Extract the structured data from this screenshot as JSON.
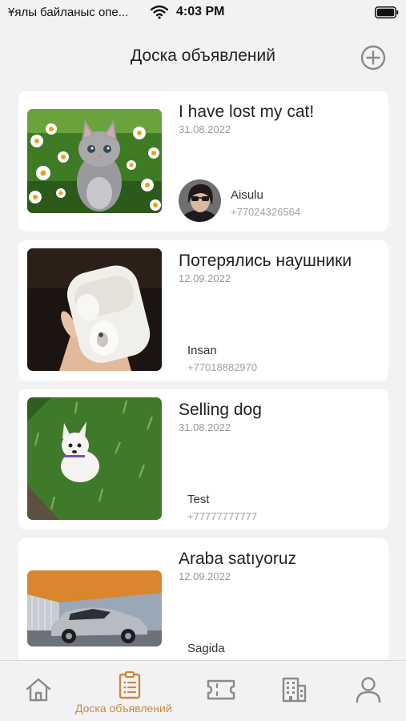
{
  "status_bar": {
    "carrier": "Ұялы байланыс опе...",
    "time": "4:03 PM"
  },
  "header": {
    "title": "Доска объявлений"
  },
  "cards": [
    {
      "title": "I have lost my cat!",
      "date": "31.08.2022",
      "name": "Aisulu",
      "phone": "+77024326564"
    },
    {
      "title": "Потерялись наушники",
      "date": "12.09.2022",
      "name": "Insan",
      "phone": "+77018882970"
    },
    {
      "title": "Selling dog",
      "date": "31.08.2022",
      "name": "Test",
      "phone": "+77777777777"
    },
    {
      "title": "Araba satıyoruz",
      "date": "12.09.2022",
      "name": "Sagida",
      "phone": ""
    }
  ],
  "tab_bar": {
    "active_label": "Доска объявлений",
    "tabs": [
      "home-icon",
      "clipboard-icon",
      "ticket-icon",
      "building-icon",
      "profile-icon"
    ]
  },
  "colors": {
    "accent": "#c58a44",
    "inactive_icon": "#8a8a8a",
    "background": "#f2f2f4",
    "card": "#ffffff"
  }
}
